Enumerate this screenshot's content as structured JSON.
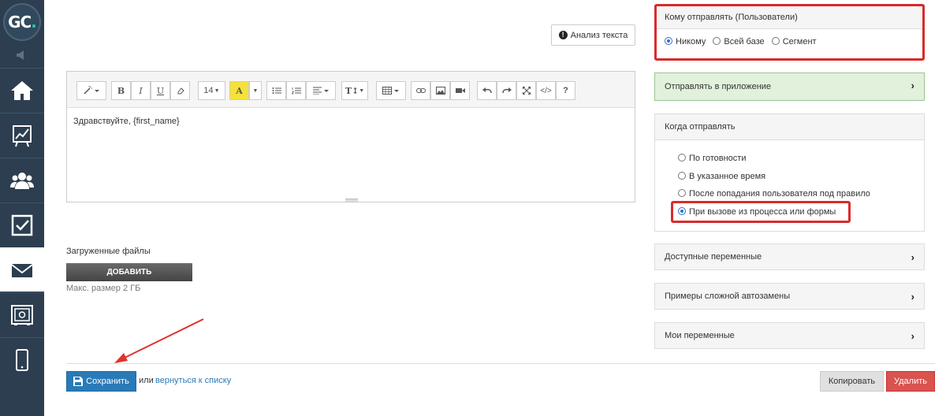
{
  "sidebar": {
    "logo": {
      "text_main": "GC",
      "text_accent": ".",
      "accent_color": "#1ec8b4"
    },
    "items": [
      {
        "icon": "home-icon"
      },
      {
        "icon": "chart-icon"
      },
      {
        "icon": "users-icon"
      },
      {
        "icon": "checkbox-icon"
      },
      {
        "icon": "mail-icon",
        "active": true
      },
      {
        "icon": "safe-icon"
      },
      {
        "icon": "mobile-icon"
      }
    ]
  },
  "editor": {
    "analyze_label": "Анализ текста",
    "font_size": "14",
    "content": "Здравствуйте, {first_name}"
  },
  "files": {
    "label": "Загруженные файлы",
    "add_label": "ДОБАВИТЬ",
    "max_size": "Макс. размер 2 ГБ"
  },
  "actions": {
    "save_label": "Сохранить",
    "or_text": "или",
    "back_link": "вернуться к списку",
    "copy_label": "Копировать",
    "delete_label": "Удалить"
  },
  "recipients": {
    "title": "Кому отправлять (Пользователи)",
    "options": [
      {
        "label": "Никому",
        "checked": true
      },
      {
        "label": "Всей базе",
        "checked": false
      },
      {
        "label": "Сегмент",
        "checked": false
      }
    ]
  },
  "app_send": {
    "label": "Отправлять в приложение",
    "bg_color": "#e1f1dc"
  },
  "when": {
    "title": "Когда отправлять",
    "options": [
      {
        "label": "По готовности",
        "checked": false
      },
      {
        "label": "В указанное время",
        "checked": false
      },
      {
        "label": "После попадания пользователя под правило",
        "checked": false
      },
      {
        "label": "При вызове из процесса или формы",
        "checked": true
      }
    ]
  },
  "sections": {
    "variables": "Доступные переменные",
    "examples": "Примеры сложной автозамены",
    "my_variables": "Мои переменные"
  },
  "colors": {
    "sidebar_bg": "#2c3e50",
    "primary": "#2a7ab8",
    "danger": "#d9534f",
    "highlight": "#d92b2b"
  }
}
